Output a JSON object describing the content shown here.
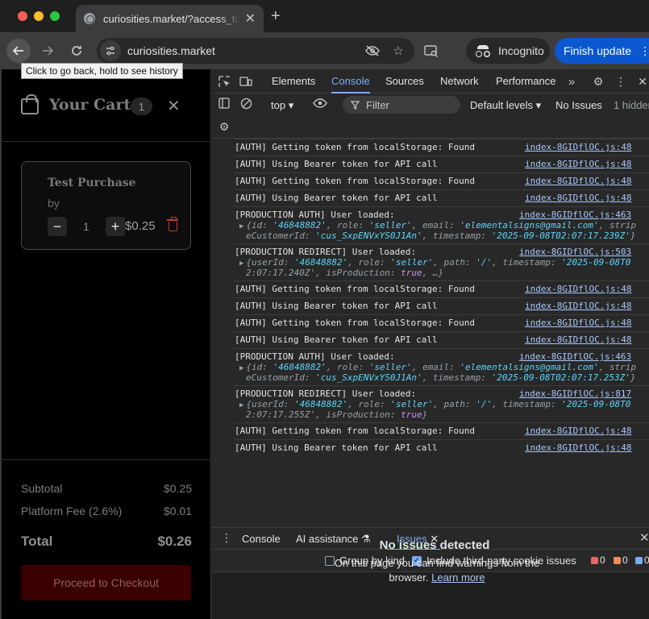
{
  "browser": {
    "tab_title": "curiosities.market/?access_to",
    "url": "curiosities.market",
    "incognito_label": "Incognito",
    "update_label": "Finish update",
    "back_tooltip": "Click to go back, hold to see history"
  },
  "cart": {
    "title": "Your Cart",
    "count": "1",
    "item": {
      "name": "Test Purchase",
      "by": "by",
      "quantity": "1",
      "price": "$0.25"
    },
    "subtotal_label": "Subtotal",
    "subtotal_value": "$0.25",
    "fee_label": "Platform Fee (2.6%)",
    "fee_value": "$0.01",
    "total_label": "Total",
    "total_value": "$0.26",
    "checkout_label": "Proceed to Checkout"
  },
  "devtools": {
    "tabs": [
      "Elements",
      "Console",
      "Sources",
      "Network",
      "Performance"
    ],
    "active_tab": "Console",
    "context": "top",
    "filter_placeholder": "Filter",
    "levels": "Default levels",
    "issues": "No Issues",
    "hidden": "1 hidden",
    "logs": [
      {
        "msg": "[AUTH] Getting token from localStorage: Found",
        "src": "index-8GIDflOC.js:48"
      },
      {
        "msg": "[AUTH] Using Bearer token for API call",
        "src": "index-8GIDflOC.js:48"
      },
      {
        "msg": "[AUTH] Getting token from localStorage: Found",
        "src": "index-8GIDflOC.js:48"
      },
      {
        "msg": "[AUTH] Using Bearer token for API call",
        "src": "index-8GIDflOC.js:48"
      },
      {
        "msg": "[PRODUCTION AUTH] User loaded:",
        "src": "index-8GIDflOC.js:463",
        "obj1": [
          "{",
          "id",
          ": ",
          "'46848882'",
          ", ",
          "role",
          ": ",
          "'seller'",
          ", ",
          "email",
          ": ",
          "'elementalsigns@gmail.com'",
          ", ",
          "strip"
        ],
        "obj2": [
          "eCustomerId",
          ": ",
          "'cus_SxpENVxYS0J1An'",
          ", ",
          "timestamp",
          ": ",
          "'2025-09-08T02:07:17.239Z'",
          "}"
        ]
      },
      {
        "msg": "[PRODUCTION REDIRECT] User loaded:",
        "src": "index-8GIDflOC.js:503",
        "obj1": [
          "{",
          "userId",
          ": ",
          "'46848882'",
          ", ",
          "role",
          ": ",
          "'seller'",
          ", ",
          "path",
          ": ",
          "'/'",
          ", ",
          "timestamp",
          ": ",
          "'2025-09-08T0"
        ],
        "obj2": [
          "2:07:17.240Z'",
          ", ",
          "isProduction",
          ": ",
          "true",
          ", …}"
        ]
      },
      {
        "msg": "[AUTH] Getting token from localStorage: Found",
        "src": "index-8GIDflOC.js:48"
      },
      {
        "msg": "[AUTH] Using Bearer token for API call",
        "src": "index-8GIDflOC.js:48"
      },
      {
        "msg": "[AUTH] Getting token from localStorage: Found",
        "src": "index-8GIDflOC.js:48"
      },
      {
        "msg": "[AUTH] Using Bearer token for API call",
        "src": "index-8GIDflOC.js:48"
      },
      {
        "msg": "[PRODUCTION AUTH] User loaded:",
        "src": "index-8GIDflOC.js:463",
        "obj1": [
          "{",
          "id",
          ": ",
          "'46848882'",
          ", ",
          "role",
          ": ",
          "'seller'",
          ", ",
          "email",
          ": ",
          "'elementalsigns@gmail.com'",
          ", ",
          "strip"
        ],
        "obj2": [
          "eCustomerId",
          ": ",
          "'cus_SxpENVxYS0J1An'",
          ", ",
          "timestamp",
          ": ",
          "'2025-09-08T02:07:17.253Z'",
          "}"
        ]
      },
      {
        "msg": "[PRODUCTION REDIRECT] User loaded:",
        "src": "index-8GIDflOC.js:817",
        "obj1": [
          "{",
          "userId",
          ": ",
          "'46848882'",
          ", ",
          "role",
          ": ",
          "'seller'",
          ", ",
          "path",
          ": ",
          "'/'",
          ", ",
          "timestamp",
          ": ",
          "'2025-09-08T0"
        ],
        "obj2": [
          "2:07:17.255Z'",
          ", ",
          "isProduction",
          ": ",
          "true",
          "}"
        ]
      },
      {
        "msg": "[AUTH] Getting token from localStorage: Found",
        "src": "index-8GIDflOC.js:48"
      },
      {
        "msg": "[AUTH] Using Bearer token for API call",
        "src": "index-8GIDflOC.js:48"
      }
    ],
    "drawer_tabs": [
      "Console",
      "AI assistance",
      "Issues"
    ],
    "active_drawer_tab": "Issues",
    "group_by_kind": "Group by kind",
    "third_party": "Include third-party cookie issues",
    "badge_errors": "0",
    "badge_warnings": "0",
    "badge_info": "0",
    "no_issues_title": "No issues detected",
    "no_issues_text": "On this page you can find warnings from the browser.",
    "learn_more": "Learn more"
  },
  "colors": {
    "accent": "#7cacf8",
    "update_button": "#0b57d0",
    "checkout": "#3a0000",
    "error_badge": "#e46962",
    "warning_badge": "#f28b54",
    "info_badge": "#7cacf8"
  }
}
